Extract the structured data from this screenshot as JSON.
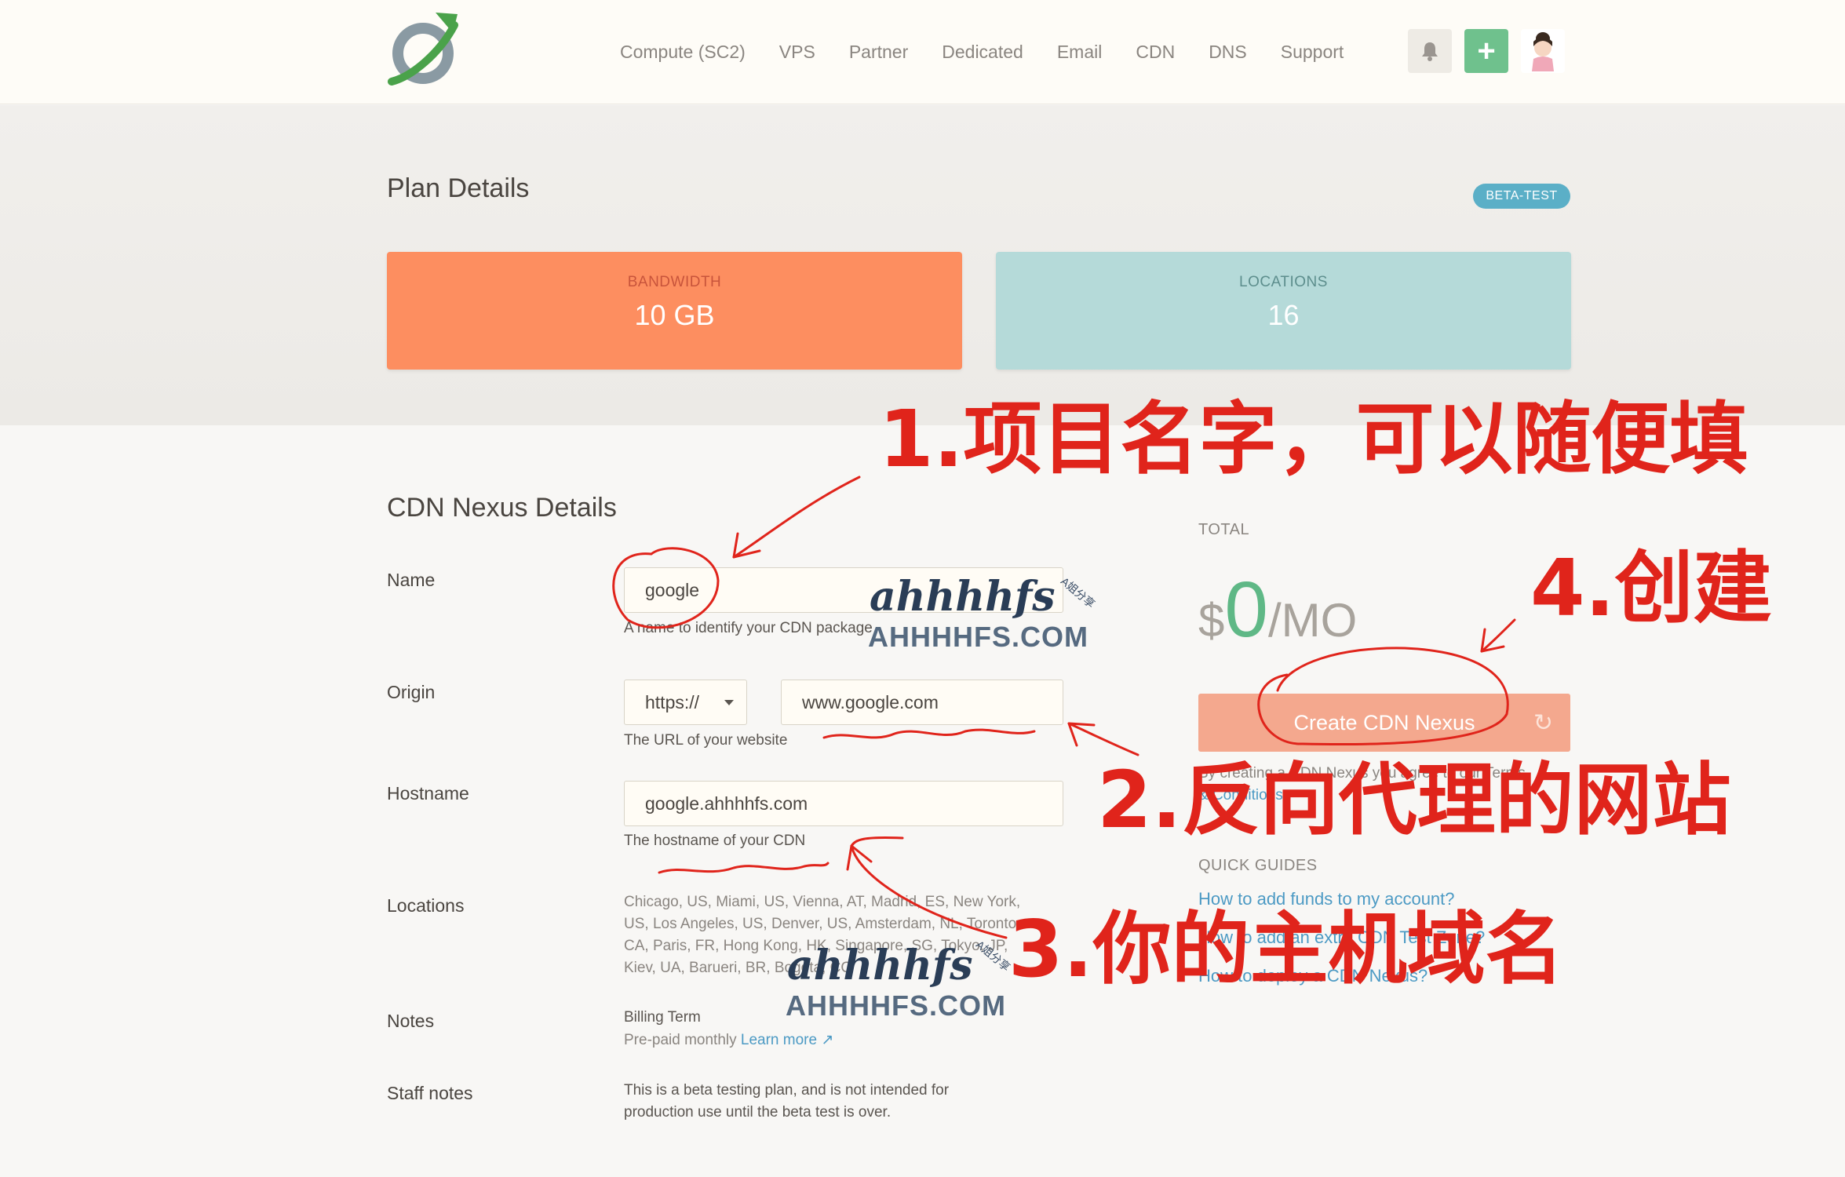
{
  "header": {
    "nav": [
      "Compute (SC2)",
      "VPS",
      "Partner",
      "Dedicated",
      "Email",
      "CDN",
      "DNS",
      "Support"
    ],
    "icons": {
      "bell": "bell-icon",
      "add": "plus-icon",
      "avatar": "avatar-icon"
    }
  },
  "plan": {
    "title": "Plan Details",
    "badge": "BETA-TEST",
    "bandwidth_label": "BANDWIDTH",
    "bandwidth_value": "10 GB",
    "locations_label": "LOCATIONS",
    "locations_value": "16"
  },
  "form": {
    "title": "CDN Nexus Details",
    "name_label": "Name",
    "name_value": "google",
    "name_help": "A name to identify your CDN package",
    "origin_label": "Origin",
    "protocol_value": "https://",
    "origin_value": "www.google.com",
    "origin_help": "The URL of your website",
    "hostname_label": "Hostname",
    "hostname_value": "google.ahhhhfs.com",
    "hostname_help": "The hostname of your CDN",
    "locations_label": "Locations",
    "locations_lines": [
      "Chicago, US, Miami, US, Vienna, AT, Madrid, ES, New York,",
      "US, Los Angeles, US, Denver, US, Amsterdam, NL, Toronto,",
      "CA, Paris, FR, Hong Kong, HK, Singapore, SG, Tokyo, JP,",
      "Kiev, UA, Barueri, BR, Bogota, CO"
    ],
    "notes_label": "Notes",
    "billing_term": "Billing Term",
    "prepaid": "Pre-paid monthly",
    "learn_more": "Learn more",
    "staff_label": "Staff notes",
    "staff_lines": [
      "This is a beta testing plan, and is not intended for",
      "production use until the beta test is over."
    ]
  },
  "summary": {
    "total_label": "TOTAL",
    "currency": "$",
    "amount": "0",
    "period": "/MO",
    "create_button": "Create CDN Nexus",
    "terms_lines": [
      "By creating a CDN Nexus you agree to our Terms",
      "& Conditions"
    ],
    "guides_title": "QUICK GUIDES",
    "guides": [
      "How to add funds to my account?",
      "How to add an extra CDN Test Zone?",
      "How to deploy a CDN Nexus?"
    ]
  },
  "annotations": {
    "step1": "1.项目名字，可以随便填",
    "step2": "2.反向代理的网站",
    "step3": "3.你的主机域名",
    "step4": "4.创建"
  },
  "watermark": {
    "script": "ahhhhfs",
    "domain": "AHHHHFS.COM",
    "tag": "A姐分享"
  },
  "colors": {
    "bandwidth_card": "#fd8e60",
    "locations_card": "#b5dad9",
    "badge": "#5bafc7",
    "price_green": "#5fb886",
    "create_button": "#f4a88e",
    "annotation_red": "#e0241b",
    "add_button": "#6fc18d"
  }
}
